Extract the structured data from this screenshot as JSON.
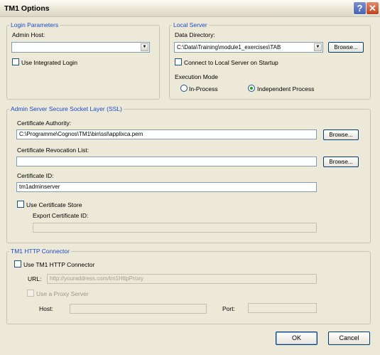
{
  "window": {
    "title": "TM1 Options",
    "help_glyph": "?",
    "close_glyph": "✕"
  },
  "login_parameters": {
    "legend": "Login Parameters",
    "admin_host_label": "Admin Host:",
    "admin_host_value": "",
    "integrated_login_label": "Use Integrated Login",
    "integrated_login_checked": false
  },
  "local_server": {
    "legend": "Local Server",
    "data_directory_label": "Data Directory:",
    "data_directory_value": "C:\\Data\\Training\\module1_exercises\\TAB",
    "browse_label": "Browse...",
    "connect_on_startup_label": "Connect to Local Server on Startup",
    "connect_on_startup_checked": false,
    "execution_mode_label": "Execution Mode",
    "modes": [
      "In-Process",
      "Independent Process"
    ],
    "selected_mode": "Independent Process"
  },
  "ssl": {
    "legend": "Admin Server Secure Socket Layer (SSL)",
    "cert_authority_label": "Certificate Authority:",
    "cert_authority_value": "C:\\Programme\\Cognos\\TM1\\bin\\ssl\\applixca.pem",
    "browse_label": "Browse...",
    "revocation_label": "Certificate Revocation List:",
    "revocation_value": "",
    "cert_id_label": "Certificate ID:",
    "cert_id_value": "tm1adminserver",
    "use_cert_store_label": "Use Certificate Store",
    "use_cert_store_checked": false,
    "export_cert_id_label": "Export Certificate ID:",
    "export_cert_id_value": ""
  },
  "http": {
    "legend": "TM1 HTTP Connector",
    "use_http_label": "Use TM1 HTTP Connector",
    "use_http_checked": false,
    "url_label": "URL:",
    "url_value": "http://youraddress.com/tm1HttpProxy",
    "proxy_label": "Use a Proxy Server",
    "host_label": "Host:",
    "host_value": "",
    "port_label": "Port:",
    "port_value": ""
  },
  "buttons": {
    "ok": "OK",
    "cancel": "Cancel"
  }
}
